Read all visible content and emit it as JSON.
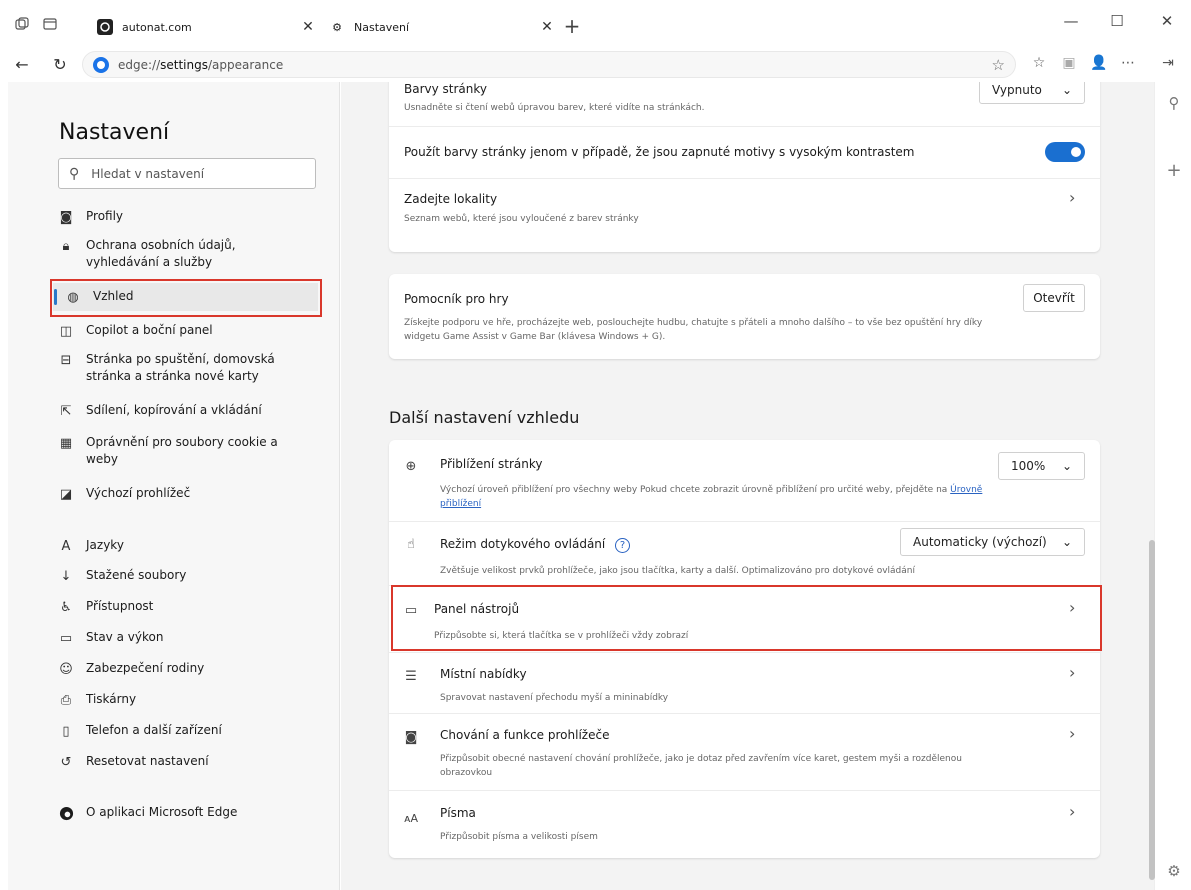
{
  "tabs": [
    {
      "label": "autonat.com"
    },
    {
      "label": "Nastavení"
    }
  ],
  "address": {
    "prefix": "edge://",
    "bold": "settings",
    "suffix": "/appearance"
  },
  "sidebar": {
    "title": "Nastavení",
    "search_placeholder": "Hledat v nastavení",
    "items": [
      {
        "label": "Profily"
      },
      {
        "label": "Ochrana osobních údajů, vyhledávání a služby"
      },
      {
        "label": "Vzhled"
      },
      {
        "label": "Copilot a boční panel"
      },
      {
        "label": "Stránka po spuštění, domovská stránka a stránka nové karty"
      },
      {
        "label": "Sdílení, kopírování a vkládání"
      },
      {
        "label": "Oprávnění pro soubory cookie a weby"
      },
      {
        "label": "Výchozí prohlížeč"
      },
      {
        "label": "Jazyky"
      },
      {
        "label": "Stažené soubory"
      },
      {
        "label": "Přístupnost"
      },
      {
        "label": "Stav a výkon"
      },
      {
        "label": "Zabezpečení rodiny"
      },
      {
        "label": "Tiskárny"
      },
      {
        "label": "Telefon a další zařízení"
      },
      {
        "label": "Resetovat nastavení"
      },
      {
        "label": "O aplikaci Microsoft Edge"
      }
    ]
  },
  "page_colors": {
    "title": "Barvy stránky",
    "desc": "Usnadněte si čtení webů úpravou barev, které vidíte na stránkách.",
    "dropdown": "Vypnuto",
    "contrast_label": "Použít barvy stránky jenom v případě, že jsou zapnuté motivy s vysokým kontrastem",
    "contrast_on": true,
    "sites_title": "Zadejte lokality",
    "sites_desc": "Seznam webů, které jsou vyloučené z barev stránky"
  },
  "game_assist": {
    "title": "Pomocník pro hry",
    "button": "Otevřít",
    "desc1": "Získejte podporu ve hře, procházejte web, poslouchejte hudbu, chatujte s přáteli a mnoho dalšího – to vše bez opuštění hry díky",
    "desc2": "widgetu Game Assist v Game Bar (klávesa Windows + G)."
  },
  "more": {
    "heading": "Další nastavení vzhledu",
    "zoom_title": "Přiblížení stránky",
    "zoom_value": "100%",
    "zoom_desc": "Výchozí úroveň přiblížení pro všechny weby Pokud chcete zobrazit úrovně přiblížení pro určité weby, přejděte na",
    "zoom_link1": "Úrovně",
    "zoom_link2": "přiblížení",
    "touch_title": "Režim dotykového ovládání",
    "touch_value": "Automaticky (výchozí)",
    "touch_desc": "Zvětšuje velikost prvků prohlížeče, jako jsou tlačítka, karty a další. Optimalizováno pro dotykové ovládání",
    "toolbar_title": "Panel nástrojů",
    "toolbar_desc": "Přizpůsobte si, která tlačítka se v prohlížeči vždy zobrazí",
    "context_title": "Místní nabídky",
    "context_desc": "Spravovat nastavení přechodu myší a mininabídky",
    "behavior_title": "Chování a funkce prohlížeče",
    "behavior_desc1": "Přizpůsobit obecné nastavení chování prohlížeče, jako je dotaz před zavřením více karet, gestem myši a rozdělenou",
    "behavior_desc2": "obrazovkou",
    "fonts_title": "Písma",
    "fonts_desc": "Přizpůsobit písma a velikosti písem"
  },
  "colors": {
    "accent": "#1a6fd0",
    "highlight_box": "#d9372b"
  }
}
